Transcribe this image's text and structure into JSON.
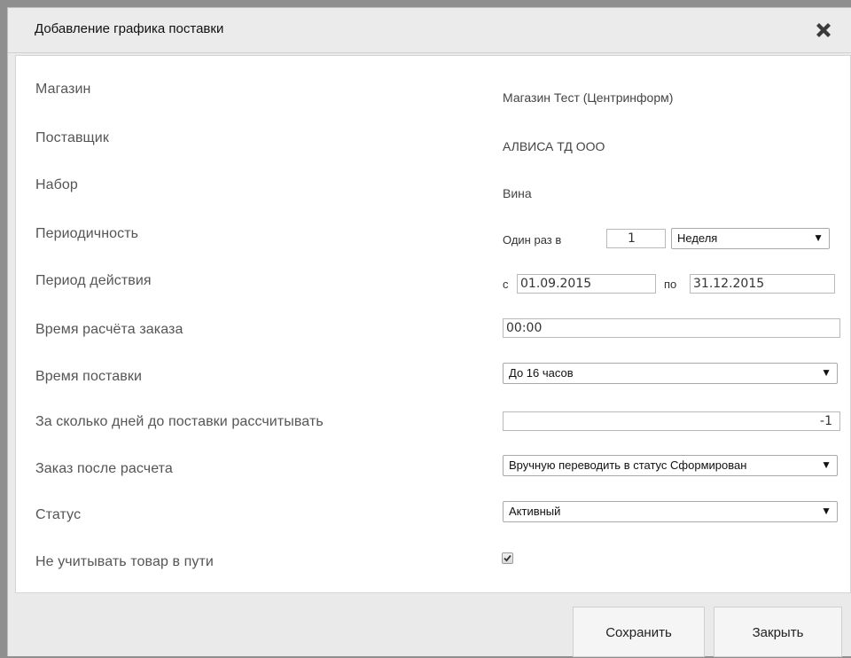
{
  "dialog": {
    "title": "Добавление графика поставки"
  },
  "form": {
    "store": {
      "label": "Магазин",
      "value": "Магазин Тест (Центринформ)"
    },
    "supplier": {
      "label": "Поставщик",
      "value": "АЛВИСА ТД ООО"
    },
    "set": {
      "label": "Набор",
      "value": "Вина"
    },
    "periodicity": {
      "label": "Периодичность",
      "prefix": "Один раз в",
      "count": "1",
      "unit": "Неделя"
    },
    "validity": {
      "label": "Период действия",
      "from_label": "с",
      "from": "01.09.2015",
      "to_label": "по",
      "to": "31.12.2015"
    },
    "calc_time": {
      "label": "Время расчёта заказа",
      "value": "00:00"
    },
    "delivery_time": {
      "label": "Время поставки",
      "value": "До 16 часов"
    },
    "days_before": {
      "label": "За сколько дней до поставки рассчитывать",
      "value": "-1"
    },
    "order_after": {
      "label": "Заказ после расчета",
      "value": "Вручную переводить в статус Сформирован"
    },
    "status": {
      "label": "Статус",
      "value": "Активный"
    },
    "ignore_transit": {
      "label": "Не учитывать товар в пути",
      "checked": true
    }
  },
  "buttons": {
    "save": "Сохранить",
    "close": "Закрыть"
  },
  "icons": {
    "close": "close-x-icon",
    "dropdown": "triangle-down-icon",
    "check": "checkmark-icon"
  }
}
